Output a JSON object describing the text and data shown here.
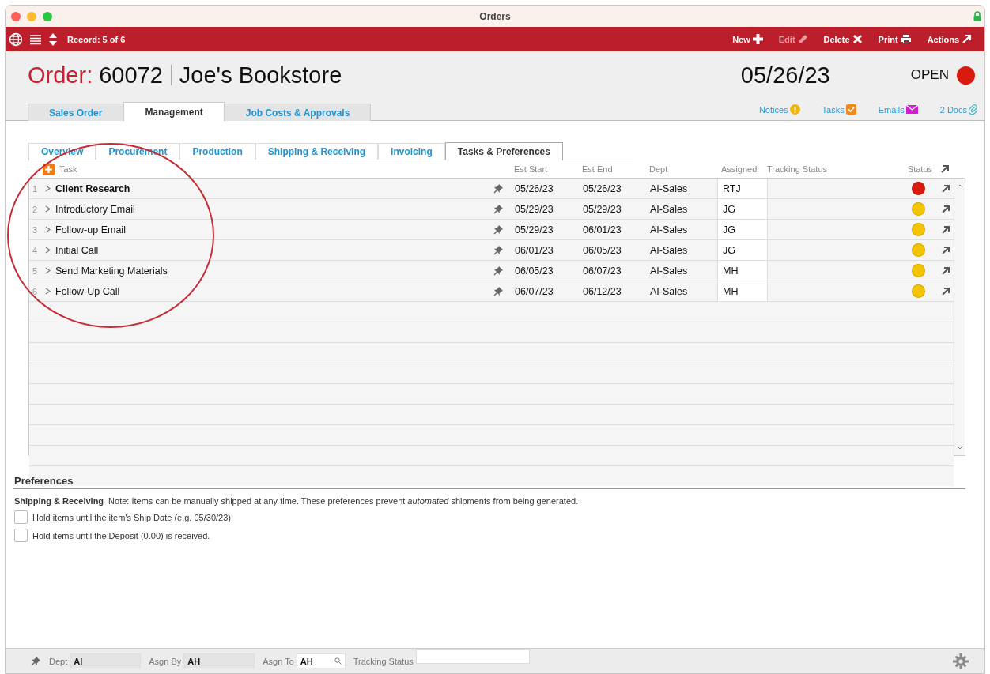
{
  "window": {
    "title": "Orders"
  },
  "toolbar": {
    "record": "Record: 5 of 6",
    "actions": [
      {
        "label": "New",
        "kind": "plus",
        "disabled": false
      },
      {
        "label": "Edit",
        "kind": "pencil",
        "disabled": true
      },
      {
        "label": "Delete",
        "kind": "cross",
        "disabled": false
      },
      {
        "label": "Print",
        "kind": "printer",
        "disabled": false
      },
      {
        "label": "Actions",
        "kind": "arrow",
        "disabled": false
      }
    ]
  },
  "header": {
    "label": "Order:",
    "number": "60072",
    "customer": "Joe's Bookstore",
    "date": "05/26/23",
    "status": {
      "label": "OPEN",
      "color": "#d91a0f"
    }
  },
  "main_tabs": [
    {
      "label": "Sales Order",
      "selected": false
    },
    {
      "label": "Management",
      "selected": true
    },
    {
      "label": "Job Costs & Approvals",
      "selected": false
    }
  ],
  "links": [
    {
      "label": "Notices",
      "kind": "notice"
    },
    {
      "label": "Tasks",
      "kind": "task"
    },
    {
      "label": "Emails",
      "kind": "email"
    },
    {
      "label": "2 Docs",
      "kind": "clip"
    }
  ],
  "sub_tabs": [
    {
      "label": "Overview",
      "selected": false
    },
    {
      "label": "Procurement",
      "selected": false
    },
    {
      "label": "Production",
      "selected": false
    },
    {
      "label": "Shipping & Receiving",
      "selected": false
    },
    {
      "label": "Invoicing",
      "selected": false
    },
    {
      "label": "Tasks & Preferences",
      "selected": true
    }
  ],
  "table": {
    "columns": [
      "Task",
      "Est Start",
      "Est End",
      "Dept",
      "Assigned",
      "Tracking Status",
      "Status"
    ],
    "rows": [
      {
        "index": "1",
        "task": "Client Research",
        "bold": true,
        "start": "05/26/23",
        "end": "05/26/23",
        "dept": "AI-Sales",
        "assigned": "RTJ",
        "color": "#d91a0f"
      },
      {
        "index": "2",
        "task": "Introductory Email",
        "bold": false,
        "start": "05/29/23",
        "end": "05/29/23",
        "dept": "AI-Sales",
        "assigned": "JG",
        "color": "#f5c400"
      },
      {
        "index": "3",
        "task": "Follow-up Email",
        "bold": false,
        "start": "05/29/23",
        "end": "06/01/23",
        "dept": "AI-Sales",
        "assigned": "JG",
        "color": "#f5c400"
      },
      {
        "index": "4",
        "task": "Initial Call",
        "bold": false,
        "start": "06/01/23",
        "end": "06/05/23",
        "dept": "AI-Sales",
        "assigned": "JG",
        "color": "#f5c400"
      },
      {
        "index": "5",
        "task": "Send Marketing Materials",
        "bold": false,
        "start": "06/05/23",
        "end": "06/07/23",
        "dept": "AI-Sales",
        "assigned": "MH",
        "color": "#f5c400"
      },
      {
        "index": "6",
        "task": "Follow-Up Call",
        "bold": false,
        "start": "06/07/23",
        "end": "06/12/23",
        "dept": "AI-Sales",
        "assigned": "MH",
        "color": "#f5c400"
      }
    ]
  },
  "preferences": {
    "title": "Preferences",
    "section": "Shipping & Receiving",
    "note": "Note: Items can be manually shipped at any time. These preferences prevent *automated* shipments from being generated.",
    "options": [
      {
        "label": "Hold items until the item's Ship Date (e.g. 05/30/23).",
        "checked": false
      },
      {
        "label": "Hold items until the Deposit (0.00) is received.",
        "checked": false
      }
    ]
  },
  "footer": {
    "fields": [
      {
        "label": "Dept",
        "value": "AI",
        "kind": "plain"
      },
      {
        "label": "Asgn By",
        "value": "AH",
        "kind": "plain"
      },
      {
        "label": "Asgn To",
        "value": "AH",
        "kind": "search"
      },
      {
        "label": "Tracking Status",
        "kind": "white"
      }
    ]
  }
}
